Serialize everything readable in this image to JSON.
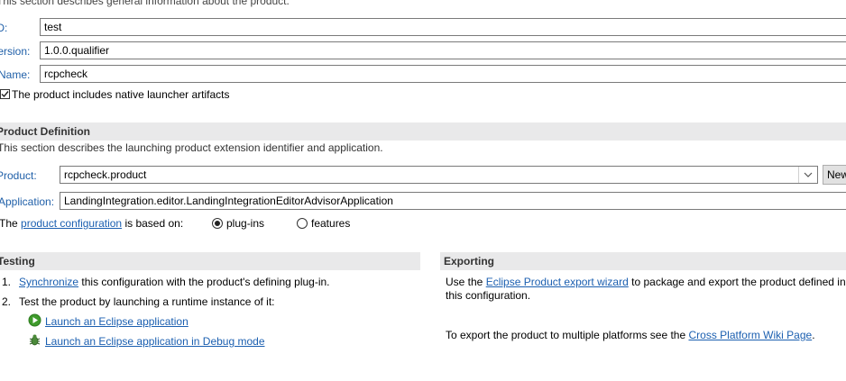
{
  "general": {
    "description": "This section describes general information about the product.",
    "id_label": "ID:",
    "id_value": "test",
    "version_label": "Version:",
    "version_value": "1.0.0.qualifier",
    "name_label": "Name:",
    "name_value": "rcpcheck",
    "native_launcher_label": "The product includes native launcher artifacts",
    "native_launcher_checked": true
  },
  "product_definition": {
    "title": "Product Definition",
    "description": "This section describes the launching product extension identifier and application.",
    "product_label": "Product:",
    "product_value": "rcpcheck.product",
    "new_button": "New...",
    "application_label": "Application:",
    "application_value": "LandingIntegration.editor.LandingIntegrationEditorAdvisorApplication",
    "based_on_prefix": "The",
    "based_on_link": "product configuration",
    "based_on_suffix": "is based on:",
    "option_plugins": "plug-ins",
    "option_features": "features",
    "selected_option": "plug-ins"
  },
  "testing": {
    "title": "Testing",
    "step1_num": "1.",
    "step1_link": "Synchronize",
    "step1_text": "this configuration with the product's defining plug-in.",
    "step2_num": "2.",
    "step2_text": "Test the product by launching a runtime instance of it:",
    "launch_link": "Launch an Eclipse application",
    "debug_link": "Launch an Eclipse application in Debug mode"
  },
  "exporting": {
    "title": "Exporting",
    "use_prefix": "Use the",
    "wizard_link": "Eclipse Product export wizard",
    "use_suffix": "to package and export the product defined in",
    "use_line2": "this configuration.",
    "cross_prefix": "To export the product to multiple platforms see the",
    "cross_link": "Cross Platform Wiki Page",
    "cross_suffix": "."
  },
  "colors": {
    "section_bar": "#e9e9ea",
    "link": "#1b5fb0",
    "label_blue": "#1f5fa8"
  }
}
